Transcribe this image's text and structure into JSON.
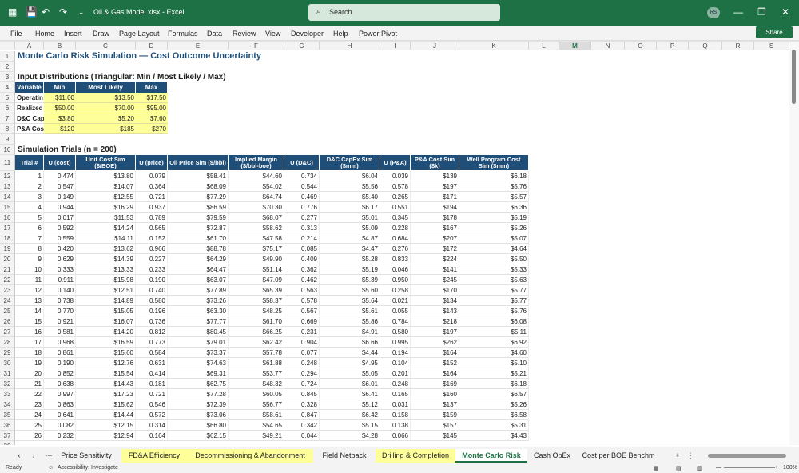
{
  "titlebar": {
    "filename": "Oil & Gas Model.xlsx",
    "app": "Excel",
    "search_placeholder": "Search",
    "avatar": "RS",
    "excel_icon": "excel-icon",
    "save_icon": "save-icon"
  },
  "menu": [
    "File",
    "Home",
    "Insert",
    "Draw",
    "Page Layout",
    "Formulas",
    "Data",
    "Review",
    "View",
    "Developer",
    "Help",
    "Power Pivot"
  ],
  "share_label": "Share",
  "columns": [
    "A",
    "B",
    "C",
    "D",
    "E",
    "F",
    "G",
    "H",
    "I",
    "J",
    "K",
    "L",
    "M",
    "N",
    "O",
    "P",
    "Q",
    "R",
    "S"
  ],
  "selected_column": "M",
  "sheet": {
    "title": "Monte Carlo Risk Simulation — Cost Outcome Uncertainty",
    "input_title": "Input Distributions (Triangular: Min / Most Likely / Max)",
    "input_headers": [
      "Variable",
      "Min",
      "Most Likely",
      "Max"
    ],
    "inputs": [
      [
        "Operatin",
        "$11.00",
        "$13.50",
        "$17.50"
      ],
      [
        "Realized",
        "$50.00",
        "$70.00",
        "$95.00"
      ],
      [
        "D&C Cap",
        "$3.80",
        "$5.20",
        "$7.60"
      ],
      [
        "P&A Cos",
        "$120",
        "$185",
        "$270"
      ]
    ],
    "sim_title": "Simulation Trials (n = 200)",
    "sim_headers": [
      "Trial #",
      "U (cost)",
      "Unit Cost Sim ($/BOE)",
      "U (price)",
      "Oil Price Sim ($/bbl)",
      "Implied Margin ($/bbl-boe)",
      "U (D&C)",
      "D&C CapEx Sim ($mm)",
      "U (P&A)",
      "P&A Cost Sim ($k)",
      "Well Program Cost Sim ($mm)"
    ],
    "trials": [
      [
        "1",
        "0.474",
        "$13.80",
        "0.079",
        "$58.41",
        "$44.60",
        "0.734",
        "$6.04",
        "0.039",
        "$139",
        "$6.18"
      ],
      [
        "2",
        "0.547",
        "$14.07",
        "0.364",
        "$68.09",
        "$54.02",
        "0.544",
        "$5.56",
        "0.578",
        "$197",
        "$5.76"
      ],
      [
        "3",
        "0.149",
        "$12.55",
        "0.721",
        "$77.29",
        "$64.74",
        "0.469",
        "$5.40",
        "0.265",
        "$171",
        "$5.57"
      ],
      [
        "4",
        "0.944",
        "$16.29",
        "0.937",
        "$86.59",
        "$70.30",
        "0.776",
        "$6.17",
        "0.551",
        "$194",
        "$6.36"
      ],
      [
        "5",
        "0.017",
        "$11.53",
        "0.789",
        "$79.59",
        "$68.07",
        "0.277",
        "$5.01",
        "0.345",
        "$178",
        "$5.19"
      ],
      [
        "6",
        "0.592",
        "$14.24",
        "0.565",
        "$72.87",
        "$58.62",
        "0.313",
        "$5.09",
        "0.228",
        "$167",
        "$5.26"
      ],
      [
        "7",
        "0.559",
        "$14.11",
        "0.152",
        "$61.70",
        "$47.58",
        "0.214",
        "$4.87",
        "0.684",
        "$207",
        "$5.07"
      ],
      [
        "8",
        "0.420",
        "$13.62",
        "0.966",
        "$88.78",
        "$75.17",
        "0.085",
        "$4.47",
        "0.276",
        "$172",
        "$4.64"
      ],
      [
        "9",
        "0.629",
        "$14.39",
        "0.227",
        "$64.29",
        "$49.90",
        "0.409",
        "$5.28",
        "0.833",
        "$224",
        "$5.50"
      ],
      [
        "10",
        "0.333",
        "$13.33",
        "0.233",
        "$64.47",
        "$51.14",
        "0.362",
        "$5.19",
        "0.046",
        "$141",
        "$5.33"
      ],
      [
        "11",
        "0.911",
        "$15.98",
        "0.190",
        "$63.07",
        "$47.09",
        "0.462",
        "$5.39",
        "0.950",
        "$245",
        "$5.63"
      ],
      [
        "12",
        "0.140",
        "$12.51",
        "0.740",
        "$77.89",
        "$65.39",
        "0.563",
        "$5.60",
        "0.258",
        "$170",
        "$5.77"
      ],
      [
        "13",
        "0.738",
        "$14.89",
        "0.580",
        "$73.26",
        "$58.37",
        "0.578",
        "$5.64",
        "0.021",
        "$134",
        "$5.77"
      ],
      [
        "14",
        "0.770",
        "$15.05",
        "0.196",
        "$63.30",
        "$48.25",
        "0.567",
        "$5.61",
        "0.055",
        "$143",
        "$5.76"
      ],
      [
        "15",
        "0.921",
        "$16.07",
        "0.736",
        "$77.77",
        "$61.70",
        "0.669",
        "$5.86",
        "0.784",
        "$218",
        "$6.08"
      ],
      [
        "16",
        "0.581",
        "$14.20",
        "0.812",
        "$80.45",
        "$66.25",
        "0.231",
        "$4.91",
        "0.580",
        "$197",
        "$5.11"
      ],
      [
        "17",
        "0.968",
        "$16.59",
        "0.773",
        "$79.01",
        "$62.42",
        "0.904",
        "$6.66",
        "0.995",
        "$262",
        "$6.92"
      ],
      [
        "18",
        "0.861",
        "$15.60",
        "0.584",
        "$73.37",
        "$57.78",
        "0.077",
        "$4.44",
        "0.194",
        "$164",
        "$4.60"
      ],
      [
        "19",
        "0.190",
        "$12.76",
        "0.631",
        "$74.63",
        "$61.88",
        "0.248",
        "$4.95",
        "0.104",
        "$152",
        "$5.10"
      ],
      [
        "20",
        "0.852",
        "$15.54",
        "0.414",
        "$69.31",
        "$53.77",
        "0.294",
        "$5.05",
        "0.201",
        "$164",
        "$5.21"
      ],
      [
        "21",
        "0.638",
        "$14.43",
        "0.181",
        "$62.75",
        "$48.32",
        "0.724",
        "$6.01",
        "0.248",
        "$169",
        "$6.18"
      ],
      [
        "22",
        "0.997",
        "$17.23",
        "0.721",
        "$77.28",
        "$60.05",
        "0.845",
        "$6.41",
        "0.165",
        "$160",
        "$6.57"
      ],
      [
        "23",
        "0.863",
        "$15.62",
        "0.546",
        "$72.39",
        "$56.77",
        "0.328",
        "$5.12",
        "0.031",
        "$137",
        "$5.26"
      ],
      [
        "24",
        "0.641",
        "$14.44",
        "0.572",
        "$73.06",
        "$58.61",
        "0.847",
        "$6.42",
        "0.158",
        "$159",
        "$6.58"
      ],
      [
        "25",
        "0.082",
        "$12.15",
        "0.314",
        "$66.80",
        "$54.65",
        "0.342",
        "$5.15",
        "0.138",
        "$157",
        "$5.31"
      ],
      [
        "26",
        "0.232",
        "$12.94",
        "0.164",
        "$62.15",
        "$49.21",
        "0.044",
        "$4.28",
        "0.066",
        "$145",
        "$4.43"
      ]
    ]
  },
  "tabs": [
    "Price Sensitivity",
    "FD&A Efficiency",
    "Decommissioning & Abandonment",
    "Field Netback",
    "Drilling & Completion",
    "Monte Carlo Risk",
    "Cash OpEx",
    "Cost per BOE Benchm"
  ],
  "active_tab": "Monte Carlo Risk",
  "status": {
    "ready": "Ready",
    "accessibility": "Accessibility: Investigate",
    "zoom": "100%"
  }
}
